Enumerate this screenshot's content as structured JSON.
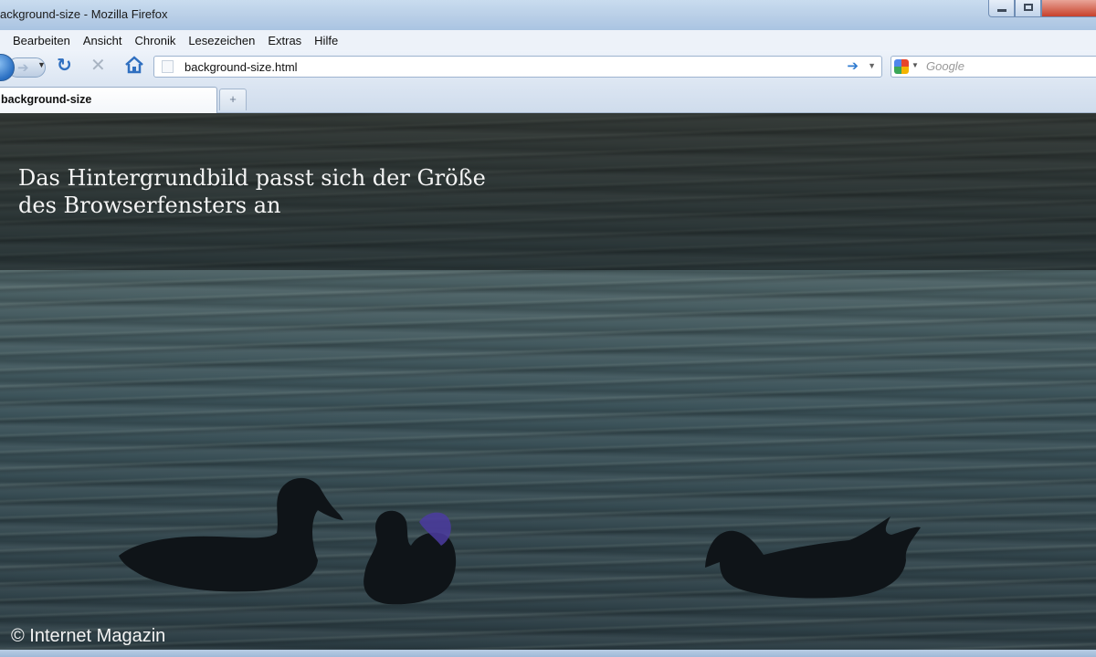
{
  "window": {
    "title": "ackground-size - Mozilla Firefox"
  },
  "menu": {
    "items": [
      "Bearbeiten",
      "Ansicht",
      "Chronik",
      "Lesezeichen",
      "Extras",
      "Hilfe"
    ]
  },
  "navigation": {
    "url": "background-size.html",
    "search_placeholder": "Google",
    "icons": [
      "back-icon",
      "forward-icon",
      "reload-icon",
      "stop-icon",
      "home-icon",
      "go-arrow-icon",
      "search-engine-icon"
    ]
  },
  "tabs": {
    "active_label": "background-size",
    "new_tab_glyph": "+"
  },
  "page": {
    "headline": "Das Hintergrundbild passt sich der Größe des Browserfensters an",
    "copyright": "© Internet Magazin"
  },
  "colors": {
    "water": "#3b5259",
    "duck_silhouette": "#0f1418",
    "headline_text": "#f4f4f4"
  }
}
